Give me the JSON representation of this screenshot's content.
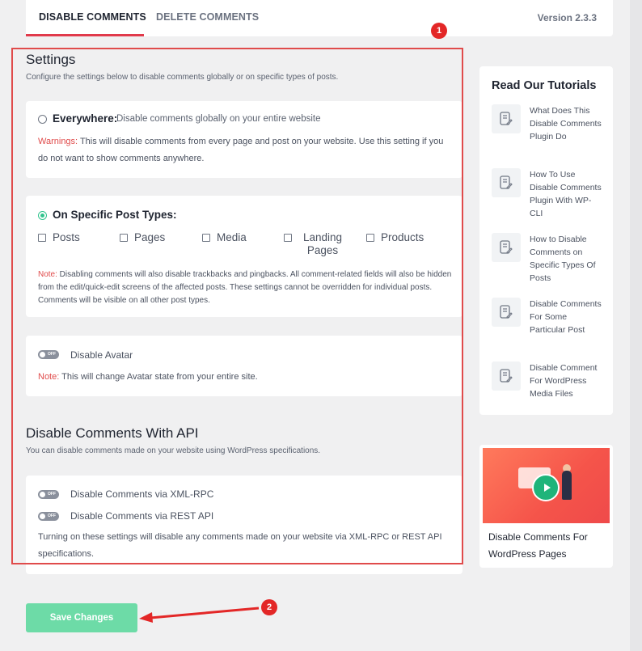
{
  "tabs": [
    {
      "label": "DISABLE COMMENTS",
      "active": true
    },
    {
      "label": "DELETE COMMENTS",
      "active": false
    }
  ],
  "version": "Version 2.3.3",
  "callouts": [
    "1",
    "2"
  ],
  "settings": {
    "title": "Settings",
    "description": "Configure the settings below to disable comments globally or on specific types of posts."
  },
  "everywhere": {
    "label": "Everywhere:",
    "description": "Disable comments globally on your entire website",
    "checked": false,
    "warning_label": "Warnings:",
    "warning_text": " This will disable comments from every page and post on your website. Use this setting if you do not want to show comments anywhere."
  },
  "specific": {
    "label": "On Specific Post Types:",
    "checked": true,
    "post_types": [
      "Posts",
      "Pages",
      "Media",
      "Landing Pages",
      "Products"
    ],
    "note_label": "Note:",
    "note_text": " Disabling comments will also disable trackbacks and pingbacks. All comment-related fields will also be hidden from the edit/quick-edit screens of the affected posts. These settings cannot be overridden for individual posts. Comments will be visible on all other post types."
  },
  "avatar": {
    "toggle_text": "OFF",
    "label": "Disable Avatar",
    "note_label": "Note:",
    "note_text": " This will change Avatar state from your entire site."
  },
  "api": {
    "title": "Disable Comments With API",
    "description": "You can disable comments made on your website using WordPress specifications.",
    "xmlrpc_label": "Disable Comments via XML-RPC",
    "rest_label": "Disable Comments via REST API",
    "toggle_text": "OFF",
    "footer_text": "Turning on these settings will disable any comments made on your website via XML-RPC or REST API specifications."
  },
  "sidebar": {
    "title": "Read Our Tutorials",
    "tutorials": [
      "What Does This Disable Comments Plugin Do",
      "How To Use Disable Comments Plugin With WP-CLI",
      "How to Disable Comments on Specific Types Of Posts",
      "Disable Comments For Some Particular Post",
      "Disable Comment For WordPress Media Files"
    ],
    "video_title": "Disable Comments For WordPress Pages"
  },
  "save_button": "Save Changes",
  "colors": {
    "accent_red": "#e13a4b",
    "green": "#31c48d",
    "save_green": "#6ddba7",
    "annotation_red": "#e32727"
  }
}
